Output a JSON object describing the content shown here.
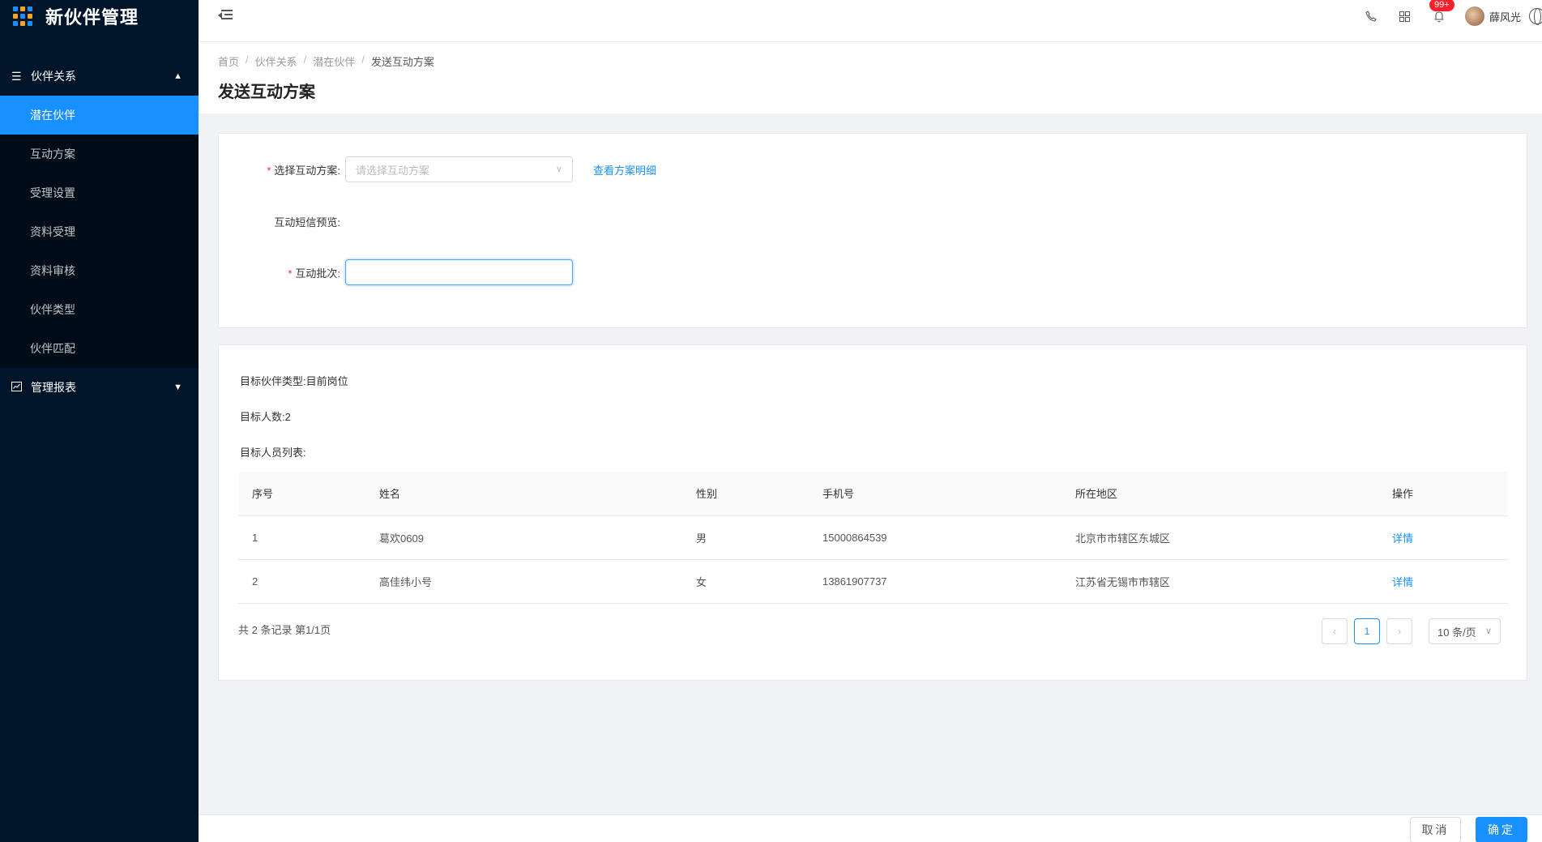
{
  "app": {
    "title": "新伙伴管理"
  },
  "sidebar": {
    "groups": [
      {
        "label": "伙伴关系",
        "icon": "menu-lines-icon",
        "expanded": true
      },
      {
        "label": "管理报表",
        "icon": "chart-icon",
        "expanded": false
      }
    ],
    "items": [
      {
        "label": "潜在伙伴",
        "active": true
      },
      {
        "label": "互动方案"
      },
      {
        "label": "受理设置"
      },
      {
        "label": "资料受理"
      },
      {
        "label": "资料审核"
      },
      {
        "label": "伙伴类型"
      },
      {
        "label": "伙伴匹配"
      }
    ]
  },
  "header": {
    "notification_badge": "99+",
    "user_name": "薛风光"
  },
  "breadcrumb": [
    "首页",
    "伙伴关系",
    "潜在伙伴",
    "发送互动方案"
  ],
  "page_title": "发送互动方案",
  "form": {
    "scheme_label": "选择互动方案:",
    "scheme_placeholder": "请选择互动方案",
    "view_detail_link": "查看方案明细",
    "sms_preview_label": "互动短信预览:",
    "batch_label": "互动批次:",
    "batch_value": ""
  },
  "target": {
    "type_label": "目标伙伴类型:",
    "type_value": "目前岗位",
    "count_label": "目标人数:",
    "count_value": "2",
    "list_label": "目标人员列表:"
  },
  "table": {
    "columns": [
      "序号",
      "姓名",
      "性别",
      "手机号",
      "所在地区",
      "操作"
    ],
    "rows": [
      {
        "index": "1",
        "name": "葛欢0609",
        "gender": "男",
        "phone": "15000864539",
        "region": "北京市市辖区东城区",
        "action": "详情"
      },
      {
        "index": "2",
        "name": "高佳纬小号",
        "gender": "女",
        "phone": "13861907737",
        "region": "江苏省无锡市市辖区",
        "action": "详情"
      }
    ]
  },
  "pagination": {
    "summary": "共 2 条记录 第1/1页",
    "current_page": "1",
    "page_size": "10 条/页"
  },
  "footer": {
    "cancel_label": "取消",
    "confirm_label": "确定"
  },
  "colors": {
    "primary": "#1890ff",
    "sidebar_bg": "#001529",
    "required": "#f5222d"
  }
}
